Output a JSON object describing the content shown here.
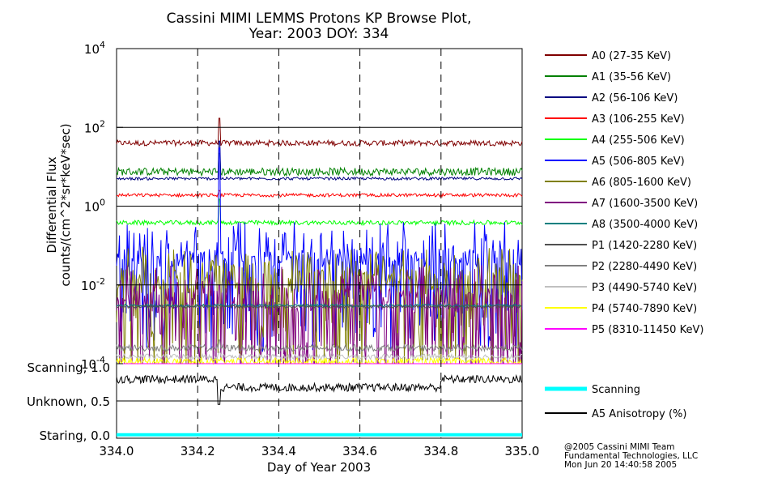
{
  "chart_data": [
    {
      "type": "line",
      "title": "Cassini MIMI LEMMS Protons KP Browse Plot,",
      "subtitle": "Year: 2003 DOY: 334",
      "ylabel": "Differential Flux",
      "ylabel2": "counts/(cm^2*sr*keV*sec)",
      "yscale": "log",
      "ylim": [
        0.0001,
        10000
      ],
      "xlim": [
        334.0,
        335.0
      ],
      "yticks": [
        {
          "value": 10000,
          "base": "10",
          "exp": "4"
        },
        {
          "value": 100,
          "base": "10",
          "exp": "2"
        },
        {
          "value": 1,
          "base": "10",
          "exp": "0"
        },
        {
          "value": 0.01,
          "base": "10",
          "exp": "-2"
        },
        {
          "value": 0.0001,
          "base": "10",
          "exp": "-4"
        }
      ],
      "grid_x": [
        334.2,
        334.4,
        334.6,
        334.8
      ],
      "grid_y": [
        100,
        1,
        0.01
      ],
      "event_x": 334.253,
      "series": [
        {
          "name": "A0 (27-35 KeV)",
          "color": "#800000",
          "level": 40,
          "noise": 0.1,
          "spike": 170
        },
        {
          "name": "A1 (35-56 KeV)",
          "color": "#008000",
          "level": 7.5,
          "noise": 0.14,
          "spike": 22
        },
        {
          "name": "A2 (56-106 KeV)",
          "color": "#000080",
          "level": 5.0,
          "noise": 0.05,
          "spike": 45
        },
        {
          "name": "A3 (106-255 KeV)",
          "color": "#ff0000",
          "level": 1.9,
          "noise": 0.06,
          "spike": 2.5
        },
        {
          "name": "A4 (255-506 KeV)",
          "color": "#00ff00",
          "level": 0.38,
          "noise": 0.08,
          "spike": 1.5
        },
        {
          "name": "A5 (506-805 KeV)",
          "color": "#0000ff",
          "level": 0.05,
          "noise": 0.35,
          "spike": 30
        },
        {
          "name": "A6 (805-1600 KeV)",
          "color": "#808000",
          "level": 0.012,
          "noise": 0.45,
          "spike": 0.03
        },
        {
          "name": "A7 (1600-3500 KeV)",
          "color": "#800080",
          "level": 0.004,
          "noise": 0.45,
          "spike": 0.01
        },
        {
          "name": "A8 (3500-4000 KeV)",
          "color": "#008080",
          "level": 0.003,
          "noise": 0.05,
          "spike": 0.003
        },
        {
          "name": "P1 (1420-2280 KeV)",
          "color": "#505050",
          "level": 0.0028,
          "noise": 0.05,
          "spike": 0.003
        },
        {
          "name": "P2 (2280-4490 KeV)",
          "color": "#808080",
          "level": 0.00025,
          "noise": 0.12,
          "spike": 0.0004
        },
        {
          "name": "P3 (4490-5740 KeV)",
          "color": "#c0c0c0",
          "level": 0.00015,
          "noise": 0.1,
          "spike": 0.0002
        },
        {
          "name": "P4 (5740-7890 KeV)",
          "color": "#ffff00",
          "level": 0.00011,
          "noise": 0.15,
          "spike": 0.00012
        },
        {
          "name": "P5 (8310-11450 KeV)",
          "color": "#ff00ff",
          "level": 0.0001,
          "noise": 0.0,
          "spike": 0.0001
        }
      ]
    },
    {
      "type": "line",
      "xlabel": "Day of Year 2003",
      "xlim": [
        334.0,
        335.0
      ],
      "xticks": [
        "334.0",
        "334.2",
        "334.4",
        "334.6",
        "334.8",
        "335.0"
      ],
      "ylim": [
        -0.05,
        1.05
      ],
      "yticks": [
        {
          "value": 1.0,
          "label": "Scanning, 1.0"
        },
        {
          "value": 0.5,
          "label": "Unknown, 0.5"
        },
        {
          "value": 0.0,
          "label": "Staring, 0.0"
        }
      ],
      "series": [
        {
          "name": "Scanning",
          "color": "#00ffff",
          "level": 0.0
        },
        {
          "name": "A5 Anisotropy (%)",
          "color": "#000000",
          "level": 0.82,
          "noise": 0.06
        }
      ]
    }
  ],
  "footer": {
    "line1": "@2005 Cassini MIMI Team",
    "line2": "Fundamental Technologies, LLC",
    "line3": "Mon Jun 20 14:40:58 2005"
  }
}
